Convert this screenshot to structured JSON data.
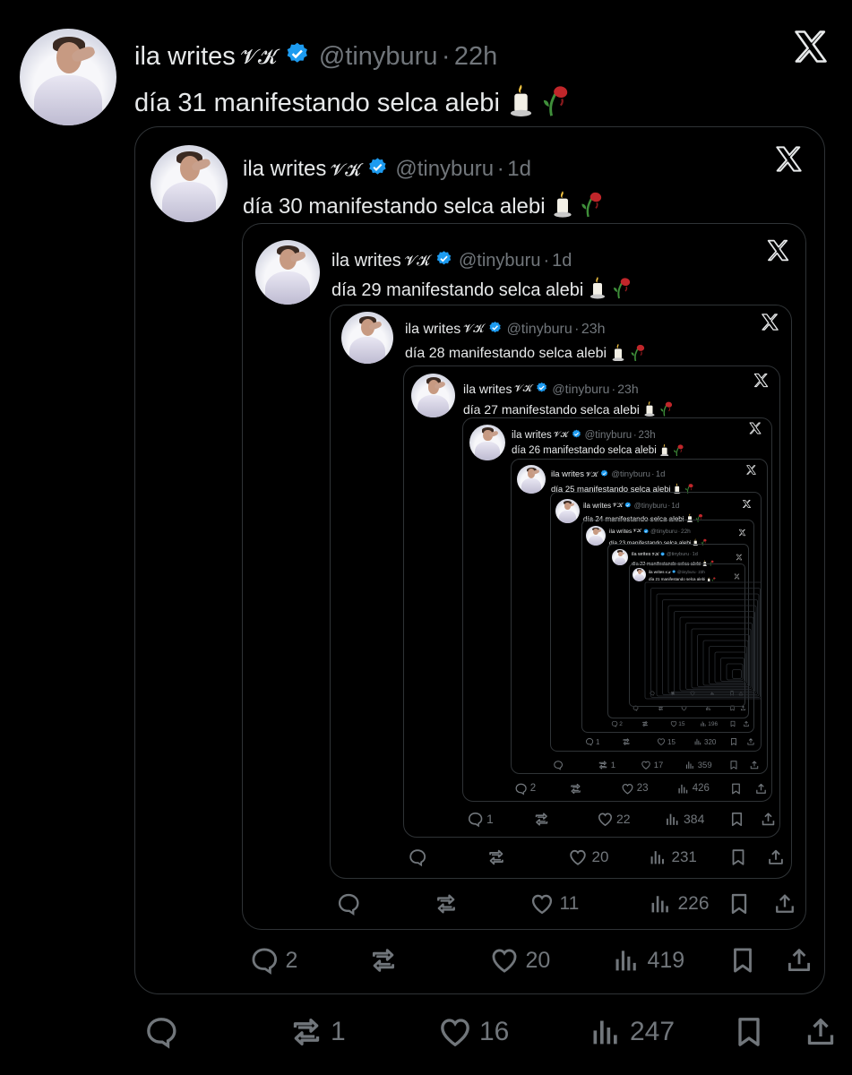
{
  "tweets": [
    {
      "name": "ila writes",
      "emoji": "𝓥𝓚",
      "handle": "@tinyburu",
      "time": "22h",
      "text": "día 31 manifestando selca alebi",
      "replies": "",
      "retweets": "1",
      "likes": "16",
      "views": "247"
    },
    {
      "name": "ila writes",
      "emoji": "𝓥𝓚",
      "handle": "@tinyburu",
      "time": "1d",
      "text": "día 30 manifestando selca alebi",
      "replies": "2",
      "retweets": "",
      "likes": "20",
      "views": "419"
    },
    {
      "name": "ila writes",
      "emoji": "𝓥𝓚",
      "handle": "@tinyburu",
      "time": "1d",
      "text": "día 29 manifestando selca alebi",
      "replies": "",
      "retweets": "",
      "likes": "11",
      "views": "226"
    },
    {
      "name": "ila writes",
      "emoji": "𝓥𝓚",
      "handle": "@tinyburu",
      "time": "23h",
      "text": "día 28 manifestando selca alebi",
      "replies": "",
      "retweets": "",
      "likes": "20",
      "views": "231"
    },
    {
      "name": "ila writes",
      "emoji": "𝓥𝓚",
      "handle": "@tinyburu",
      "time": "23h",
      "text": "día 27 manifestando selca alebi",
      "replies": "1",
      "retweets": "",
      "likes": "22",
      "views": "384"
    },
    {
      "name": "ila writes",
      "emoji": "𝓥𝓚",
      "handle": "@tinyburu",
      "time": "23h",
      "text": "día 26 manifestando selca alebi",
      "replies": "2",
      "retweets": "",
      "likes": "23",
      "views": "426"
    },
    {
      "name": "ila writes",
      "emoji": "𝓥𝓚",
      "handle": "@tinyburu",
      "time": "1d",
      "text": "día 25 manifestando selca alebi",
      "replies": "",
      "retweets": "1",
      "likes": "17",
      "views": "359"
    },
    {
      "name": "ila writes",
      "emoji": "𝓥𝓚",
      "handle": "@tinyburu",
      "time": "1d",
      "text": "día 24 manifestando selca alebi",
      "replies": "1",
      "retweets": "",
      "likes": "15",
      "views": "320"
    },
    {
      "name": "ila writes",
      "emoji": "𝓥𝓚",
      "handle": "@tinyburu",
      "time": "22h",
      "text": "día 23 manifestando selca alebi",
      "replies": "2",
      "retweets": "",
      "likes": "15",
      "views": "196"
    },
    {
      "name": "ila writes",
      "emoji": "𝓥𝓚",
      "handle": "@tinyburu",
      "time": "1d",
      "text": "día 22 manifestando selca alebi",
      "replies": "",
      "retweets": "",
      "likes": "",
      "views": ""
    },
    {
      "name": "ila writes",
      "emoji": "𝓥𝓚",
      "handle": "@tinyburu",
      "time": "23h",
      "text": "día 21 manifestando selca alebi",
      "replies": "",
      "retweets": "",
      "likes": "",
      "views": ""
    }
  ],
  "icons": {
    "verified": "verified-badge-icon",
    "x_logo": "x-logo-icon",
    "reply": "reply-icon",
    "retweet": "retweet-icon",
    "like": "heart-icon",
    "views": "views-icon",
    "bookmark": "bookmark-icon",
    "share": "share-icon",
    "candle": "candle-icon",
    "rose": "wilted-rose-icon"
  },
  "colors": {
    "background": "#000000",
    "text": "#e7e9ea",
    "muted": "#71767b",
    "border": "#2f3336",
    "verified": "#1d9bf0",
    "rose": "#c0262a"
  }
}
